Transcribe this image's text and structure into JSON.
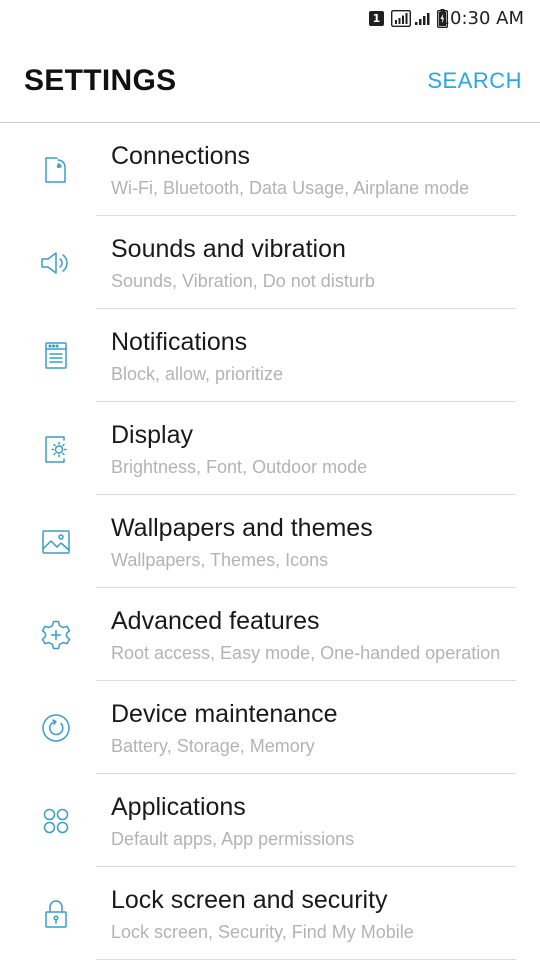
{
  "status_bar": {
    "sim_label": "1",
    "time": "10:30 AM"
  },
  "header": {
    "title": "SETTINGS",
    "search_label": "SEARCH"
  },
  "colors": {
    "accent": "#2aa6e6",
    "icon": "#3a9ec4",
    "subtitle": "#b3b3b3"
  },
  "settings": [
    {
      "icon": "connections-icon",
      "title": "Connections",
      "subtitle": "Wi-Fi, Bluetooth, Data Usage, Airplane mode"
    },
    {
      "icon": "sound-icon",
      "title": "Sounds and vibration",
      "subtitle": "Sounds, Vibration, Do not disturb"
    },
    {
      "icon": "notifications-icon",
      "title": "Notifications",
      "subtitle": "Block, allow, prioritize"
    },
    {
      "icon": "display-icon",
      "title": "Display",
      "subtitle": "Brightness, Font, Outdoor mode"
    },
    {
      "icon": "wallpaper-icon",
      "title": "Wallpapers and themes",
      "subtitle": "Wallpapers, Themes, Icons"
    },
    {
      "icon": "advanced-features-icon",
      "title": "Advanced features",
      "subtitle": "Root access, Easy mode, One-handed operation"
    },
    {
      "icon": "device-maintenance-icon",
      "title": "Device maintenance",
      "subtitle": "Battery, Storage, Memory"
    },
    {
      "icon": "applications-icon",
      "title": "Applications",
      "subtitle": "Default apps, App permissions"
    },
    {
      "icon": "lock-icon",
      "title": "Lock screen and security",
      "subtitle": "Lock screen, Security, Find My Mobile"
    }
  ]
}
